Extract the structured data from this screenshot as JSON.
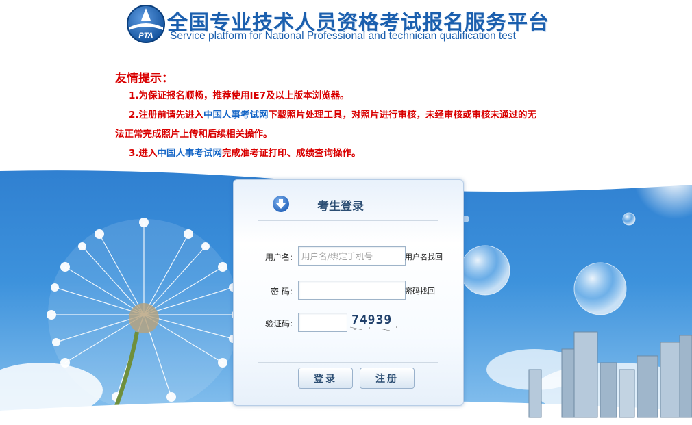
{
  "header": {
    "title_cn": "全国专业技术人员资格考试报名服务平台",
    "title_en": "Service platform for National Professional and technician qualification test",
    "logo_text": "PTA"
  },
  "notice": {
    "title": "友情提示：",
    "line1": "1.为保证报名顺畅，推荐使用IE7及以上版本浏览器。",
    "line2_prefix": "2.注册前请先进入",
    "line2_link": "中国人事考试网",
    "line2_suffix": "下载照片处理工具，对照片进行审核，未经审核或审核未通过的无",
    "line2_cont": "法正常完成照片上传和后续相关操作。",
    "line3_prefix": "3.进入",
    "line3_link": "中国人事考试网",
    "line3_suffix": "完成准考证打印、成绩查询操作。"
  },
  "login": {
    "title": "考生登录",
    "username_label": "用户名:",
    "username_placeholder": "用户名/绑定手机号",
    "username_value": "",
    "username_recover": "用户名找回",
    "password_label": "密 码:",
    "password_value": "",
    "password_recover": "密码找回",
    "captcha_label": "验证码:",
    "captcha_value": "",
    "captcha_text": "74939",
    "login_button": "登录",
    "register_button": "注册"
  },
  "colors": {
    "brand_blue": "#1b5fae",
    "notice_red": "#d90000",
    "link_blue": "#1264c6"
  }
}
